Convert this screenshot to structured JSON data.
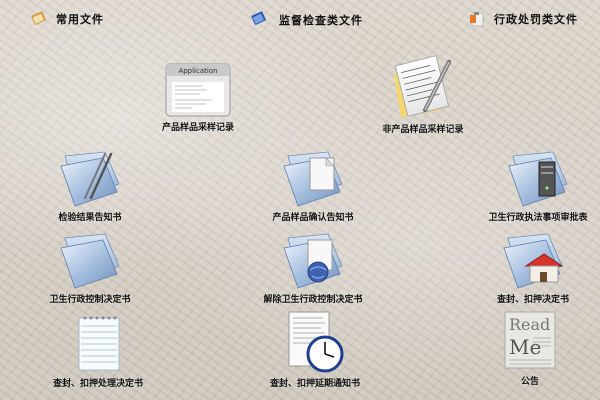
{
  "tabs": [
    {
      "label": "常用文件",
      "icon": "book-icon"
    },
    {
      "label": "监督检查类文件",
      "icon": "blue-book-icon"
    },
    {
      "label": "行政处罚类文件",
      "icon": "clipboard-icon"
    }
  ],
  "items": [
    {
      "label": "产品样品采样记录",
      "icon": "application-window-icon"
    },
    {
      "label": "非产品样品采样记录",
      "icon": "pen-notepad-icon"
    },
    {
      "label": "检验结果告知书",
      "icon": "folder-pen-icon"
    },
    {
      "label": "产品样品确认告知书",
      "icon": "folder-document-icon"
    },
    {
      "label": "卫生行政执法事项审批表",
      "icon": "folder-server-icon"
    },
    {
      "label": "卫生行政控制决定书",
      "icon": "folder-icon"
    },
    {
      "label": "解除卫生行政控制决定书",
      "icon": "folder-globe-icon"
    },
    {
      "label": "查封、扣押决定书",
      "icon": "folder-home-icon"
    },
    {
      "label": "查封、扣押处理决定书",
      "icon": "notepad-icon"
    },
    {
      "label": "查封、扣押延期通知书",
      "icon": "document-clock-icon"
    },
    {
      "label": "公告",
      "icon": "newspaper-icon"
    }
  ],
  "app_window_title": "Application",
  "newspaper_text": [
    "Read",
    "Me"
  ]
}
